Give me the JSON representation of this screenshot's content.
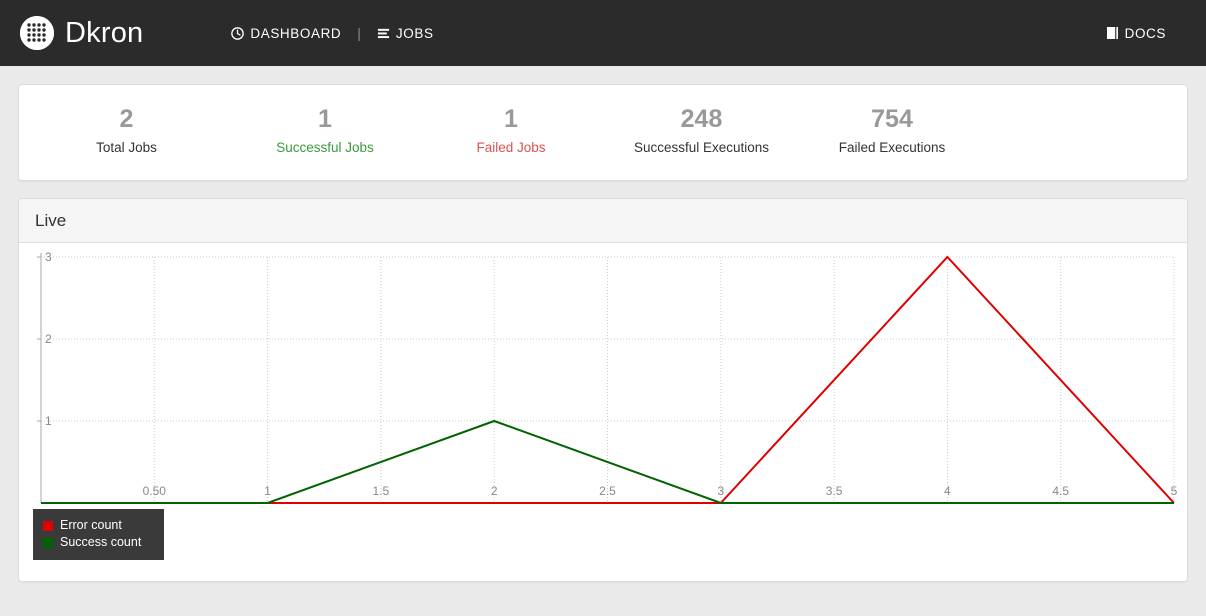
{
  "navbar": {
    "brand": "Dkron",
    "brand_icon": "dkron-dots-logo-icon",
    "separator": "|",
    "links": [
      {
        "label": "DASHBOARD",
        "icon": "dashboard-clock-icon"
      },
      {
        "label": "JOBS",
        "icon": "jobs-list-icon"
      }
    ],
    "right_links": [
      {
        "label": "DOCS",
        "icon": "book-icon"
      }
    ],
    "background": "#2b2b2b"
  },
  "stats": [
    {
      "value": "2",
      "label": "Total Jobs",
      "style": "default"
    },
    {
      "value": "1",
      "label": "Successful Jobs",
      "style": "success"
    },
    {
      "value": "1",
      "label": "Failed Jobs",
      "style": "danger"
    },
    {
      "value": "248",
      "label": "Successful Executions",
      "style": "default"
    },
    {
      "value": "754",
      "label": "Failed Executions",
      "style": "default"
    }
  ],
  "chart_panel": {
    "title": "Live"
  },
  "colors": {
    "error": "#e00000",
    "success": "#006400",
    "stat_number": "#999999",
    "success_text": "#3c9a3c",
    "danger_text": "#d9534f",
    "grid": "#cccccc",
    "axis": "#aaaaaa",
    "tick_label": "#888888",
    "legend_bg": "#3a3a3a"
  },
  "chart_data": {
    "type": "line",
    "title": "Live",
    "xlabel": "",
    "ylabel": "",
    "xlim": [
      0,
      5
    ],
    "ylim": [
      0,
      3
    ],
    "grid": true,
    "legend_position": "bottom-left",
    "x_ticks": [
      0.5,
      1,
      1.5,
      2,
      2.5,
      3,
      3.5,
      4,
      4.5,
      5
    ],
    "x_tick_labels": [
      "0.50",
      "1",
      "1.5",
      "2",
      "2.5",
      "3",
      "3.5",
      "4",
      "4.5",
      "5"
    ],
    "y_ticks": [
      1,
      2,
      3
    ],
    "y_tick_labels": [
      "1",
      "2",
      "3"
    ],
    "x": [
      0,
      1,
      2,
      3,
      4,
      5
    ],
    "series": [
      {
        "name": "Error count",
        "color": "#e00000",
        "values": [
          0,
          0,
          0,
          0,
          3,
          0
        ]
      },
      {
        "name": "Success count",
        "color": "#006400",
        "values": [
          0,
          0,
          1,
          0,
          0,
          0
        ]
      }
    ]
  }
}
